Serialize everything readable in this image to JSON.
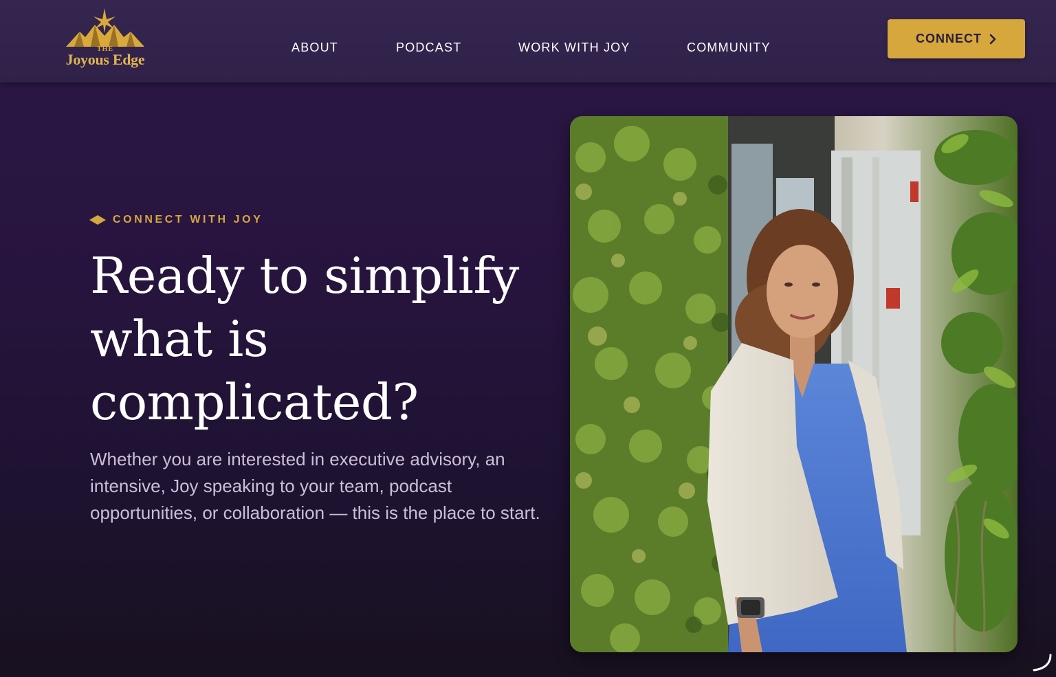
{
  "header": {
    "logo": {
      "small_text": "THE",
      "name": "Joyous Edge"
    },
    "nav": [
      {
        "label": "ABOUT"
      },
      {
        "label": "PODCAST"
      },
      {
        "label": "WORK WITH JOY"
      },
      {
        "label": "COMMUNITY"
      }
    ],
    "cta": {
      "label": "CONNECT",
      "icon": "chevron-right-icon"
    }
  },
  "hero": {
    "eyebrow": "CONNECT WITH JOY",
    "title_lines": [
      "Ready to simplify",
      "what is",
      "complicated?"
    ],
    "body": "Whether you are interested in executive advisory, an intensive, Joy speaking to your team, podcast opportunities, or collaboration — this is the place to start."
  },
  "colors": {
    "accent_gold": "#d6a73c",
    "background_purple": "#27143e",
    "header_purple": "#352650"
  }
}
